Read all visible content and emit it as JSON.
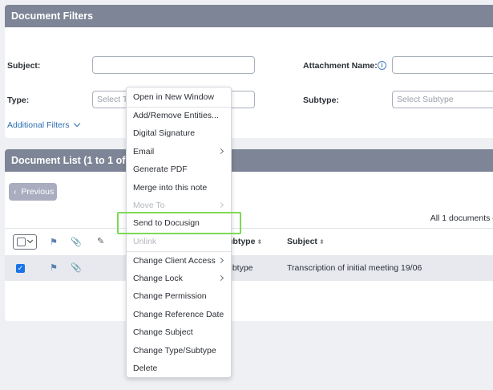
{
  "filters": {
    "title": "Document Filters",
    "subject_label": "Subject:",
    "subject_value": "",
    "attachment_label": "Attachment Name:",
    "attachment_value": "",
    "type_label": "Type:",
    "type_placeholder": "Select Ty",
    "subtype_label": "Subtype:",
    "subtype_placeholder": "Select Subtype",
    "additional_filters": "Additional Filters"
  },
  "doclist": {
    "title": "Document List (1 to 1 of 1",
    "previous": "Previous",
    "count": "All 1 documents on",
    "headers": {
      "subtype": "ubtype",
      "subject": "Subject"
    },
    "row": {
      "subtype": "ubtype",
      "subject": "Transcription of initial meeting 19/06"
    }
  },
  "menu": {
    "items": [
      {
        "label": "Open in New Window",
        "disabled": false,
        "submenu": false
      },
      {
        "label": "Add/Remove Entities...",
        "disabled": false,
        "submenu": false
      },
      {
        "label": "Digital Signature",
        "disabled": false,
        "submenu": false
      },
      {
        "label": "Email",
        "disabled": false,
        "submenu": true
      },
      {
        "label": "Generate PDF",
        "disabled": false,
        "submenu": false
      },
      {
        "label": "Merge into this note",
        "disabled": false,
        "submenu": false
      },
      {
        "label": "Move To",
        "disabled": true,
        "submenu": true
      },
      {
        "label": "Send to Docusign",
        "disabled": false,
        "submenu": false
      },
      {
        "label": "Unlink",
        "disabled": true,
        "submenu": false
      },
      {
        "label": "Change Client Access",
        "disabled": false,
        "submenu": true
      },
      {
        "label": "Change Lock",
        "disabled": false,
        "submenu": true
      },
      {
        "label": "Change Permission",
        "disabled": false,
        "submenu": false
      },
      {
        "label": "Change Reference Date",
        "disabled": false,
        "submenu": false
      },
      {
        "label": "Change Subject",
        "disabled": false,
        "submenu": false
      },
      {
        "label": "Change Type/Subtype",
        "disabled": false,
        "submenu": false
      },
      {
        "label": "Delete",
        "disabled": false,
        "submenu": false
      }
    ]
  },
  "colors": {
    "header": "#7d8596",
    "link": "#2e6fb3",
    "highlight": "#7ed957",
    "checkbox": "#1a73e8"
  }
}
